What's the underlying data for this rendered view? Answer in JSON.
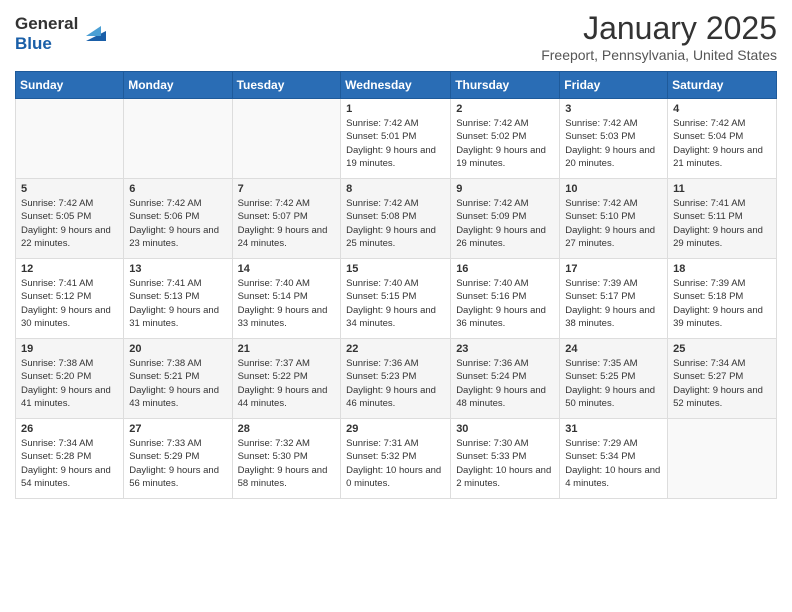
{
  "header": {
    "logo_general": "General",
    "logo_blue": "Blue",
    "month_title": "January 2025",
    "location": "Freeport, Pennsylvania, United States"
  },
  "days_of_week": [
    "Sunday",
    "Monday",
    "Tuesday",
    "Wednesday",
    "Thursday",
    "Friday",
    "Saturday"
  ],
  "weeks": [
    [
      {
        "day": "",
        "sunrise": "",
        "sunset": "",
        "daylight": ""
      },
      {
        "day": "",
        "sunrise": "",
        "sunset": "",
        "daylight": ""
      },
      {
        "day": "",
        "sunrise": "",
        "sunset": "",
        "daylight": ""
      },
      {
        "day": "1",
        "sunrise": "Sunrise: 7:42 AM",
        "sunset": "Sunset: 5:01 PM",
        "daylight": "Daylight: 9 hours and 19 minutes."
      },
      {
        "day": "2",
        "sunrise": "Sunrise: 7:42 AM",
        "sunset": "Sunset: 5:02 PM",
        "daylight": "Daylight: 9 hours and 19 minutes."
      },
      {
        "day": "3",
        "sunrise": "Sunrise: 7:42 AM",
        "sunset": "Sunset: 5:03 PM",
        "daylight": "Daylight: 9 hours and 20 minutes."
      },
      {
        "day": "4",
        "sunrise": "Sunrise: 7:42 AM",
        "sunset": "Sunset: 5:04 PM",
        "daylight": "Daylight: 9 hours and 21 minutes."
      }
    ],
    [
      {
        "day": "5",
        "sunrise": "Sunrise: 7:42 AM",
        "sunset": "Sunset: 5:05 PM",
        "daylight": "Daylight: 9 hours and 22 minutes."
      },
      {
        "day": "6",
        "sunrise": "Sunrise: 7:42 AM",
        "sunset": "Sunset: 5:06 PM",
        "daylight": "Daylight: 9 hours and 23 minutes."
      },
      {
        "day": "7",
        "sunrise": "Sunrise: 7:42 AM",
        "sunset": "Sunset: 5:07 PM",
        "daylight": "Daylight: 9 hours and 24 minutes."
      },
      {
        "day": "8",
        "sunrise": "Sunrise: 7:42 AM",
        "sunset": "Sunset: 5:08 PM",
        "daylight": "Daylight: 9 hours and 25 minutes."
      },
      {
        "day": "9",
        "sunrise": "Sunrise: 7:42 AM",
        "sunset": "Sunset: 5:09 PM",
        "daylight": "Daylight: 9 hours and 26 minutes."
      },
      {
        "day": "10",
        "sunrise": "Sunrise: 7:42 AM",
        "sunset": "Sunset: 5:10 PM",
        "daylight": "Daylight: 9 hours and 27 minutes."
      },
      {
        "day": "11",
        "sunrise": "Sunrise: 7:41 AM",
        "sunset": "Sunset: 5:11 PM",
        "daylight": "Daylight: 9 hours and 29 minutes."
      }
    ],
    [
      {
        "day": "12",
        "sunrise": "Sunrise: 7:41 AM",
        "sunset": "Sunset: 5:12 PM",
        "daylight": "Daylight: 9 hours and 30 minutes."
      },
      {
        "day": "13",
        "sunrise": "Sunrise: 7:41 AM",
        "sunset": "Sunset: 5:13 PM",
        "daylight": "Daylight: 9 hours and 31 minutes."
      },
      {
        "day": "14",
        "sunrise": "Sunrise: 7:40 AM",
        "sunset": "Sunset: 5:14 PM",
        "daylight": "Daylight: 9 hours and 33 minutes."
      },
      {
        "day": "15",
        "sunrise": "Sunrise: 7:40 AM",
        "sunset": "Sunset: 5:15 PM",
        "daylight": "Daylight: 9 hours and 34 minutes."
      },
      {
        "day": "16",
        "sunrise": "Sunrise: 7:40 AM",
        "sunset": "Sunset: 5:16 PM",
        "daylight": "Daylight: 9 hours and 36 minutes."
      },
      {
        "day": "17",
        "sunrise": "Sunrise: 7:39 AM",
        "sunset": "Sunset: 5:17 PM",
        "daylight": "Daylight: 9 hours and 38 minutes."
      },
      {
        "day": "18",
        "sunrise": "Sunrise: 7:39 AM",
        "sunset": "Sunset: 5:18 PM",
        "daylight": "Daylight: 9 hours and 39 minutes."
      }
    ],
    [
      {
        "day": "19",
        "sunrise": "Sunrise: 7:38 AM",
        "sunset": "Sunset: 5:20 PM",
        "daylight": "Daylight: 9 hours and 41 minutes."
      },
      {
        "day": "20",
        "sunrise": "Sunrise: 7:38 AM",
        "sunset": "Sunset: 5:21 PM",
        "daylight": "Daylight: 9 hours and 43 minutes."
      },
      {
        "day": "21",
        "sunrise": "Sunrise: 7:37 AM",
        "sunset": "Sunset: 5:22 PM",
        "daylight": "Daylight: 9 hours and 44 minutes."
      },
      {
        "day": "22",
        "sunrise": "Sunrise: 7:36 AM",
        "sunset": "Sunset: 5:23 PM",
        "daylight": "Daylight: 9 hours and 46 minutes."
      },
      {
        "day": "23",
        "sunrise": "Sunrise: 7:36 AM",
        "sunset": "Sunset: 5:24 PM",
        "daylight": "Daylight: 9 hours and 48 minutes."
      },
      {
        "day": "24",
        "sunrise": "Sunrise: 7:35 AM",
        "sunset": "Sunset: 5:25 PM",
        "daylight": "Daylight: 9 hours and 50 minutes."
      },
      {
        "day": "25",
        "sunrise": "Sunrise: 7:34 AM",
        "sunset": "Sunset: 5:27 PM",
        "daylight": "Daylight: 9 hours and 52 minutes."
      }
    ],
    [
      {
        "day": "26",
        "sunrise": "Sunrise: 7:34 AM",
        "sunset": "Sunset: 5:28 PM",
        "daylight": "Daylight: 9 hours and 54 minutes."
      },
      {
        "day": "27",
        "sunrise": "Sunrise: 7:33 AM",
        "sunset": "Sunset: 5:29 PM",
        "daylight": "Daylight: 9 hours and 56 minutes."
      },
      {
        "day": "28",
        "sunrise": "Sunrise: 7:32 AM",
        "sunset": "Sunset: 5:30 PM",
        "daylight": "Daylight: 9 hours and 58 minutes."
      },
      {
        "day": "29",
        "sunrise": "Sunrise: 7:31 AM",
        "sunset": "Sunset: 5:32 PM",
        "daylight": "Daylight: 10 hours and 0 minutes."
      },
      {
        "day": "30",
        "sunrise": "Sunrise: 7:30 AM",
        "sunset": "Sunset: 5:33 PM",
        "daylight": "Daylight: 10 hours and 2 minutes."
      },
      {
        "day": "31",
        "sunrise": "Sunrise: 7:29 AM",
        "sunset": "Sunset: 5:34 PM",
        "daylight": "Daylight: 10 hours and 4 minutes."
      },
      {
        "day": "",
        "sunrise": "",
        "sunset": "",
        "daylight": ""
      }
    ]
  ]
}
